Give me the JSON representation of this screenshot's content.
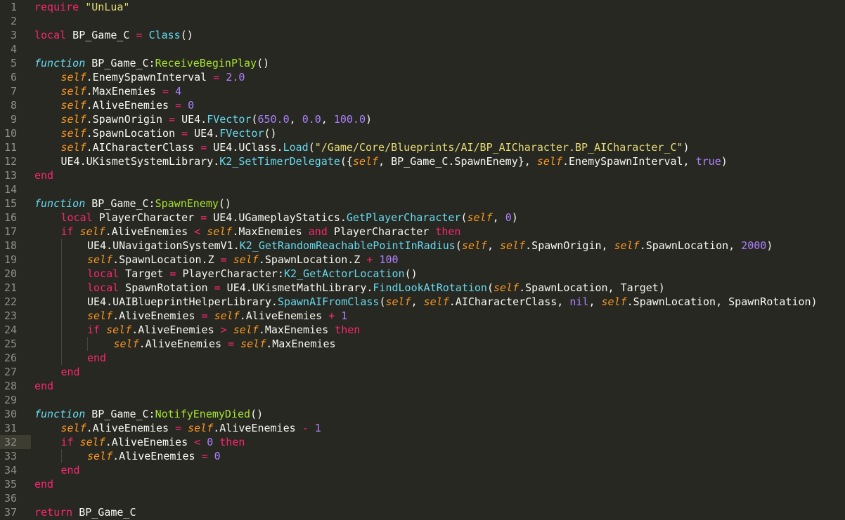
{
  "editor": {
    "current_line": 32,
    "colors": {
      "background": "#272822",
      "gutter_text": "#90908a",
      "current_line_highlight": "#3e3d32",
      "keyword": "#f92672",
      "function_keyword": "#66d9ef",
      "self": "#fd971f",
      "number": "#ae81ff",
      "string": "#e6db74",
      "call": "#66d9ef",
      "definition": "#a6e22e",
      "plain": "#f8f8f2"
    },
    "lines": [
      {
        "n": "1",
        "indent": 0,
        "tokens": [
          [
            "kw",
            "require"
          ],
          [
            "plain",
            " "
          ],
          [
            "str",
            "\"UnLua\""
          ]
        ]
      },
      {
        "n": "2",
        "indent": 0,
        "tokens": []
      },
      {
        "n": "3",
        "indent": 0,
        "tokens": [
          [
            "kw",
            "local"
          ],
          [
            "plain",
            " BP_Game_C "
          ],
          [
            "op",
            "="
          ],
          [
            "plain",
            " "
          ],
          [
            "call",
            "Class"
          ],
          [
            "plain",
            "()"
          ]
        ]
      },
      {
        "n": "4",
        "indent": 0,
        "tokens": []
      },
      {
        "n": "5",
        "indent": 0,
        "tokens": [
          [
            "fnkw",
            "function"
          ],
          [
            "plain",
            " BP_Game_C:"
          ],
          [
            "def",
            "ReceiveBeginPlay"
          ],
          [
            "plain",
            "()"
          ]
        ]
      },
      {
        "n": "6",
        "indent": 1,
        "tokens": [
          [
            "self",
            "self"
          ],
          [
            "plain",
            ".EnemySpawnInterval "
          ],
          [
            "op",
            "="
          ],
          [
            "plain",
            " "
          ],
          [
            "num",
            "2.0"
          ]
        ]
      },
      {
        "n": "7",
        "indent": 1,
        "tokens": [
          [
            "self",
            "self"
          ],
          [
            "plain",
            ".MaxEnemies "
          ],
          [
            "op",
            "="
          ],
          [
            "plain",
            " "
          ],
          [
            "num",
            "4"
          ]
        ]
      },
      {
        "n": "8",
        "indent": 1,
        "tokens": [
          [
            "self",
            "self"
          ],
          [
            "plain",
            ".AliveEnemies "
          ],
          [
            "op",
            "="
          ],
          [
            "plain",
            " "
          ],
          [
            "num",
            "0"
          ]
        ]
      },
      {
        "n": "9",
        "indent": 1,
        "tokens": [
          [
            "self",
            "self"
          ],
          [
            "plain",
            ".SpawnOrigin "
          ],
          [
            "op",
            "="
          ],
          [
            "plain",
            " UE4."
          ],
          [
            "call",
            "FVector"
          ],
          [
            "plain",
            "("
          ],
          [
            "num",
            "650.0"
          ],
          [
            "plain",
            ", "
          ],
          [
            "num",
            "0.0"
          ],
          [
            "plain",
            ", "
          ],
          [
            "num",
            "100.0"
          ],
          [
            "plain",
            ")"
          ]
        ]
      },
      {
        "n": "10",
        "indent": 1,
        "tokens": [
          [
            "self",
            "self"
          ],
          [
            "plain",
            ".SpawnLocation "
          ],
          [
            "op",
            "="
          ],
          [
            "plain",
            " UE4."
          ],
          [
            "call",
            "FVector"
          ],
          [
            "plain",
            "()"
          ]
        ]
      },
      {
        "n": "11",
        "indent": 1,
        "tokens": [
          [
            "self",
            "self"
          ],
          [
            "plain",
            ".AICharacterClass "
          ],
          [
            "op",
            "="
          ],
          [
            "plain",
            " UE4.UClass."
          ],
          [
            "call",
            "Load"
          ],
          [
            "plain",
            "("
          ],
          [
            "str",
            "\"/Game/Core/Blueprints/AI/BP_AICharacter.BP_AICharacter_C\""
          ],
          [
            "plain",
            ")"
          ]
        ]
      },
      {
        "n": "12",
        "indent": 1,
        "tokens": [
          [
            "plain",
            "UE4.UKismetSystemLibrary."
          ],
          [
            "call",
            "K2_SetTimerDelegate"
          ],
          [
            "plain",
            "({"
          ],
          [
            "self",
            "self"
          ],
          [
            "plain",
            ", BP_Game_C.SpawnEnemy}, "
          ],
          [
            "self",
            "self"
          ],
          [
            "plain",
            ".EnemySpawnInterval, "
          ],
          [
            "num",
            "true"
          ],
          [
            "plain",
            ")"
          ]
        ]
      },
      {
        "n": "13",
        "indent": 0,
        "tokens": [
          [
            "kw",
            "end"
          ]
        ]
      },
      {
        "n": "14",
        "indent": 0,
        "tokens": []
      },
      {
        "n": "15",
        "indent": 0,
        "tokens": [
          [
            "fnkw",
            "function"
          ],
          [
            "plain",
            " BP_Game_C:"
          ],
          [
            "def",
            "SpawnEnemy"
          ],
          [
            "plain",
            "()"
          ]
        ]
      },
      {
        "n": "16",
        "indent": 1,
        "tokens": [
          [
            "kw",
            "local"
          ],
          [
            "plain",
            " PlayerCharacter "
          ],
          [
            "op",
            "="
          ],
          [
            "plain",
            " UE4.UGameplayStatics."
          ],
          [
            "call",
            "GetPlayerCharacter"
          ],
          [
            "plain",
            "("
          ],
          [
            "self",
            "self"
          ],
          [
            "plain",
            ", "
          ],
          [
            "num",
            "0"
          ],
          [
            "plain",
            ")"
          ]
        ]
      },
      {
        "n": "17",
        "indent": 1,
        "tokens": [
          [
            "kw",
            "if"
          ],
          [
            "plain",
            " "
          ],
          [
            "self",
            "self"
          ],
          [
            "plain",
            ".AliveEnemies "
          ],
          [
            "op",
            "<"
          ],
          [
            "plain",
            " "
          ],
          [
            "self",
            "self"
          ],
          [
            "plain",
            ".MaxEnemies "
          ],
          [
            "kw",
            "and"
          ],
          [
            "plain",
            " PlayerCharacter "
          ],
          [
            "kw",
            "then"
          ]
        ]
      },
      {
        "n": "18",
        "indent": 2,
        "tokens": [
          [
            "plain",
            "UE4.UNavigationSystemV1."
          ],
          [
            "call",
            "K2_GetRandomReachablePointInRadius"
          ],
          [
            "plain",
            "("
          ],
          [
            "self",
            "self"
          ],
          [
            "plain",
            ", "
          ],
          [
            "self",
            "self"
          ],
          [
            "plain",
            ".SpawnOrigin, "
          ],
          [
            "self",
            "self"
          ],
          [
            "plain",
            ".SpawnLocation, "
          ],
          [
            "num",
            "2000"
          ],
          [
            "plain",
            ")"
          ]
        ]
      },
      {
        "n": "19",
        "indent": 2,
        "tokens": [
          [
            "self",
            "self"
          ],
          [
            "plain",
            ".SpawnLocation.Z "
          ],
          [
            "op",
            "="
          ],
          [
            "plain",
            " "
          ],
          [
            "self",
            "self"
          ],
          [
            "plain",
            ".SpawnLocation.Z "
          ],
          [
            "op",
            "+"
          ],
          [
            "plain",
            " "
          ],
          [
            "num",
            "100"
          ]
        ]
      },
      {
        "n": "20",
        "indent": 2,
        "tokens": [
          [
            "kw",
            "local"
          ],
          [
            "plain",
            " Target "
          ],
          [
            "op",
            "="
          ],
          [
            "plain",
            " PlayerCharacter:"
          ],
          [
            "call",
            "K2_GetActorLocation"
          ],
          [
            "plain",
            "()"
          ]
        ]
      },
      {
        "n": "21",
        "indent": 2,
        "tokens": [
          [
            "kw",
            "local"
          ],
          [
            "plain",
            " SpawnRotation "
          ],
          [
            "op",
            "="
          ],
          [
            "plain",
            " UE4.UKismetMathLibrary."
          ],
          [
            "call",
            "FindLookAtRotation"
          ],
          [
            "plain",
            "("
          ],
          [
            "self",
            "self"
          ],
          [
            "plain",
            ".SpawnLocation, Target)"
          ]
        ]
      },
      {
        "n": "22",
        "indent": 2,
        "tokens": [
          [
            "plain",
            "UE4.UAIBlueprintHelperLibrary."
          ],
          [
            "call",
            "SpawnAIFromClass"
          ],
          [
            "plain",
            "("
          ],
          [
            "self",
            "self"
          ],
          [
            "plain",
            ", "
          ],
          [
            "self",
            "self"
          ],
          [
            "plain",
            ".AICharacterClass, "
          ],
          [
            "num",
            "nil"
          ],
          [
            "plain",
            ", "
          ],
          [
            "self",
            "self"
          ],
          [
            "plain",
            ".SpawnLocation, SpawnRotation)"
          ]
        ]
      },
      {
        "n": "23",
        "indent": 2,
        "tokens": [
          [
            "self",
            "self"
          ],
          [
            "plain",
            ".AliveEnemies "
          ],
          [
            "op",
            "="
          ],
          [
            "plain",
            " "
          ],
          [
            "self",
            "self"
          ],
          [
            "plain",
            ".AliveEnemies "
          ],
          [
            "op",
            "+"
          ],
          [
            "plain",
            " "
          ],
          [
            "num",
            "1"
          ]
        ]
      },
      {
        "n": "24",
        "indent": 2,
        "tokens": [
          [
            "kw",
            "if"
          ],
          [
            "plain",
            " "
          ],
          [
            "self",
            "self"
          ],
          [
            "plain",
            ".AliveEnemies "
          ],
          [
            "op",
            ">"
          ],
          [
            "plain",
            " "
          ],
          [
            "self",
            "self"
          ],
          [
            "plain",
            ".MaxEnemies "
          ],
          [
            "kw",
            "then"
          ]
        ]
      },
      {
        "n": "25",
        "indent": 3,
        "tokens": [
          [
            "self",
            "self"
          ],
          [
            "plain",
            ".AliveEnemies "
          ],
          [
            "op",
            "="
          ],
          [
            "plain",
            " "
          ],
          [
            "self",
            "self"
          ],
          [
            "plain",
            ".MaxEnemies"
          ]
        ]
      },
      {
        "n": "26",
        "indent": 2,
        "tokens": [
          [
            "kw",
            "end"
          ]
        ]
      },
      {
        "n": "27",
        "indent": 1,
        "tokens": [
          [
            "kw",
            "end"
          ]
        ]
      },
      {
        "n": "28",
        "indent": 0,
        "tokens": [
          [
            "kw",
            "end"
          ]
        ]
      },
      {
        "n": "29",
        "indent": 0,
        "tokens": []
      },
      {
        "n": "30",
        "indent": 0,
        "tokens": [
          [
            "fnkw",
            "function"
          ],
          [
            "plain",
            " BP_Game_C:"
          ],
          [
            "def",
            "NotifyEnemyDied"
          ],
          [
            "plain",
            "()"
          ]
        ]
      },
      {
        "n": "31",
        "indent": 1,
        "tokens": [
          [
            "self",
            "self"
          ],
          [
            "plain",
            ".AliveEnemies "
          ],
          [
            "op",
            "="
          ],
          [
            "plain",
            " "
          ],
          [
            "self",
            "self"
          ],
          [
            "plain",
            ".AliveEnemies "
          ],
          [
            "op",
            "-"
          ],
          [
            "plain",
            " "
          ],
          [
            "num",
            "1"
          ]
        ]
      },
      {
        "n": "32",
        "indent": 1,
        "tokens": [
          [
            "kw",
            "if"
          ],
          [
            "plain",
            " "
          ],
          [
            "self",
            "self"
          ],
          [
            "plain",
            ".AliveEnemies "
          ],
          [
            "op",
            "<"
          ],
          [
            "plain",
            " "
          ],
          [
            "num",
            "0"
          ],
          [
            "plain",
            " "
          ],
          [
            "kw",
            "then"
          ]
        ]
      },
      {
        "n": "33",
        "indent": 2,
        "tokens": [
          [
            "self",
            "self"
          ],
          [
            "plain",
            ".AliveEnemies "
          ],
          [
            "op",
            "="
          ],
          [
            "plain",
            " "
          ],
          [
            "num",
            "0"
          ]
        ]
      },
      {
        "n": "34",
        "indent": 1,
        "tokens": [
          [
            "kw",
            "end"
          ]
        ]
      },
      {
        "n": "35",
        "indent": 0,
        "tokens": [
          [
            "kw",
            "end"
          ]
        ]
      },
      {
        "n": "36",
        "indent": 0,
        "tokens": []
      },
      {
        "n": "37",
        "indent": 0,
        "tokens": [
          [
            "kw",
            "return"
          ],
          [
            "plain",
            " BP_Game_C"
          ]
        ]
      }
    ]
  }
}
